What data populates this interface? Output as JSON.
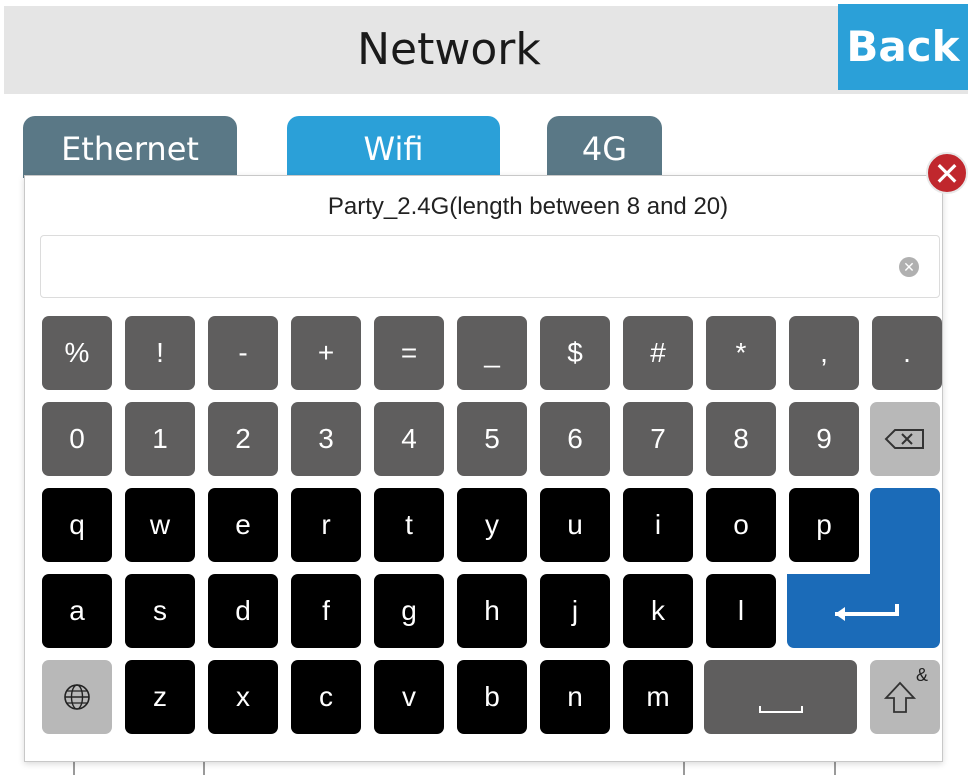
{
  "header": {
    "title": "Network",
    "back_label": "Back"
  },
  "tabs": [
    {
      "label": "Ethernet"
    },
    {
      "label": "Wifi"
    },
    {
      "label": "4G"
    }
  ],
  "dialog": {
    "prompt": "Party_2.4G(length between 8 and 20)",
    "input_value": "",
    "input_placeholder": ""
  },
  "keyboard": {
    "row1": [
      "%",
      "!",
      "-",
      "+",
      "=",
      "_",
      "$",
      "#",
      "*",
      ",",
      "."
    ],
    "row2": [
      "0",
      "1",
      "2",
      "3",
      "4",
      "5",
      "6",
      "7",
      "8",
      "9"
    ],
    "row3": [
      "q",
      "w",
      "e",
      "r",
      "t",
      "y",
      "u",
      "i",
      "o",
      "p"
    ],
    "row4": [
      "a",
      "s",
      "d",
      "f",
      "g",
      "h",
      "j",
      "k",
      "l"
    ],
    "row5": [
      "z",
      "x",
      "c",
      "v",
      "b",
      "n",
      "m"
    ],
    "shift_alt_label": "&",
    "icons": {
      "backspace": "backspace-icon",
      "enter": "enter-icon",
      "globe": "globe-icon",
      "space": "space-icon",
      "shift": "shift-icon",
      "clear": "clear-icon",
      "close": "close-icon"
    }
  },
  "colors": {
    "accent_blue": "#2ba0d8",
    "tab_inactive": "#5a7886",
    "key_gray": "#5f5e5e",
    "key_black": "#000000",
    "key_light": "#b8b8b8",
    "enter_blue": "#1b6bb8",
    "close_red": "#c0272d"
  }
}
